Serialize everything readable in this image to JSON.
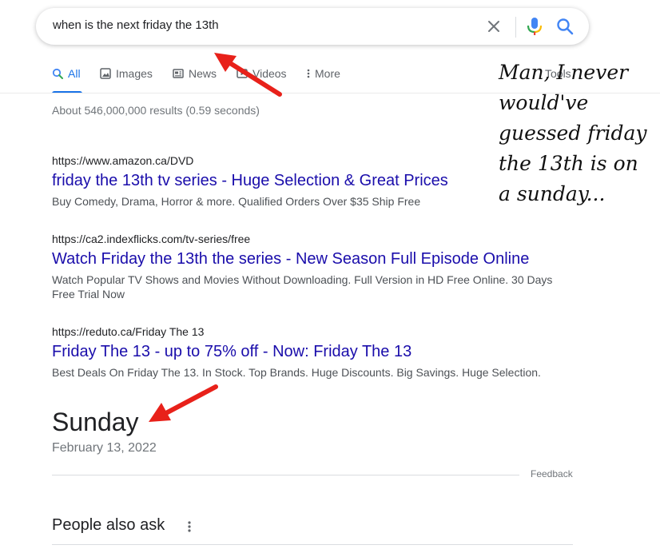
{
  "search": {
    "query": "when is the next friday the 13th",
    "clear_icon": "close-icon",
    "mic_icon": "microphone-icon",
    "search_icon": "search-icon"
  },
  "tabs": [
    {
      "label": "All",
      "icon": "search-icon"
    },
    {
      "label": "Images",
      "icon": "image-icon"
    },
    {
      "label": "News",
      "icon": "news-icon"
    },
    {
      "label": "Videos",
      "icon": "video-icon"
    },
    {
      "label": "More",
      "icon": "more-vert-icon"
    },
    {
      "label": "Tools"
    }
  ],
  "result_stats": "About 546,000,000 results (0.59 seconds)",
  "ads": [
    {
      "url": "https://www.amazon.ca/DVD",
      "title": "friday the 13th tv series - Huge Selection & Great Prices",
      "description": "Buy Comedy, Drama, Horror & more. Qualified Orders Over $35 Ship Free"
    },
    {
      "url": "https://ca2.indexflicks.com/tv-series/free",
      "title": "Watch Friday the 13th the series - New Season Full Episode Online",
      "description": "Watch Popular TV Shows and Movies Without Downloading. Full Version in HD Free Online. 30 Days Free Trial Now"
    },
    {
      "url": "https://reduto.ca/Friday The 13",
      "title": "Friday The 13 - up to 75% off - Now: Friday The 13",
      "description": "Best Deals On Friday The 13. In Stock. Top Brands. Huge Discounts. Big Savings. Huge Selection."
    }
  ],
  "answer": {
    "day": "Sunday",
    "date": "February 13, 2022",
    "feedback": "Feedback"
  },
  "people_also_ask": {
    "title": "People also ask",
    "menu_icon": "more-vert-icon"
  },
  "annotation": {
    "text": "Man, I never\nwould've\nguessed friday\nthe 13th is on\na sunday...",
    "arrow_color": "#e8211a"
  },
  "colors": {
    "link": "#1a0dab",
    "accent": "#1a73e8",
    "arrow": "#e8211a"
  }
}
